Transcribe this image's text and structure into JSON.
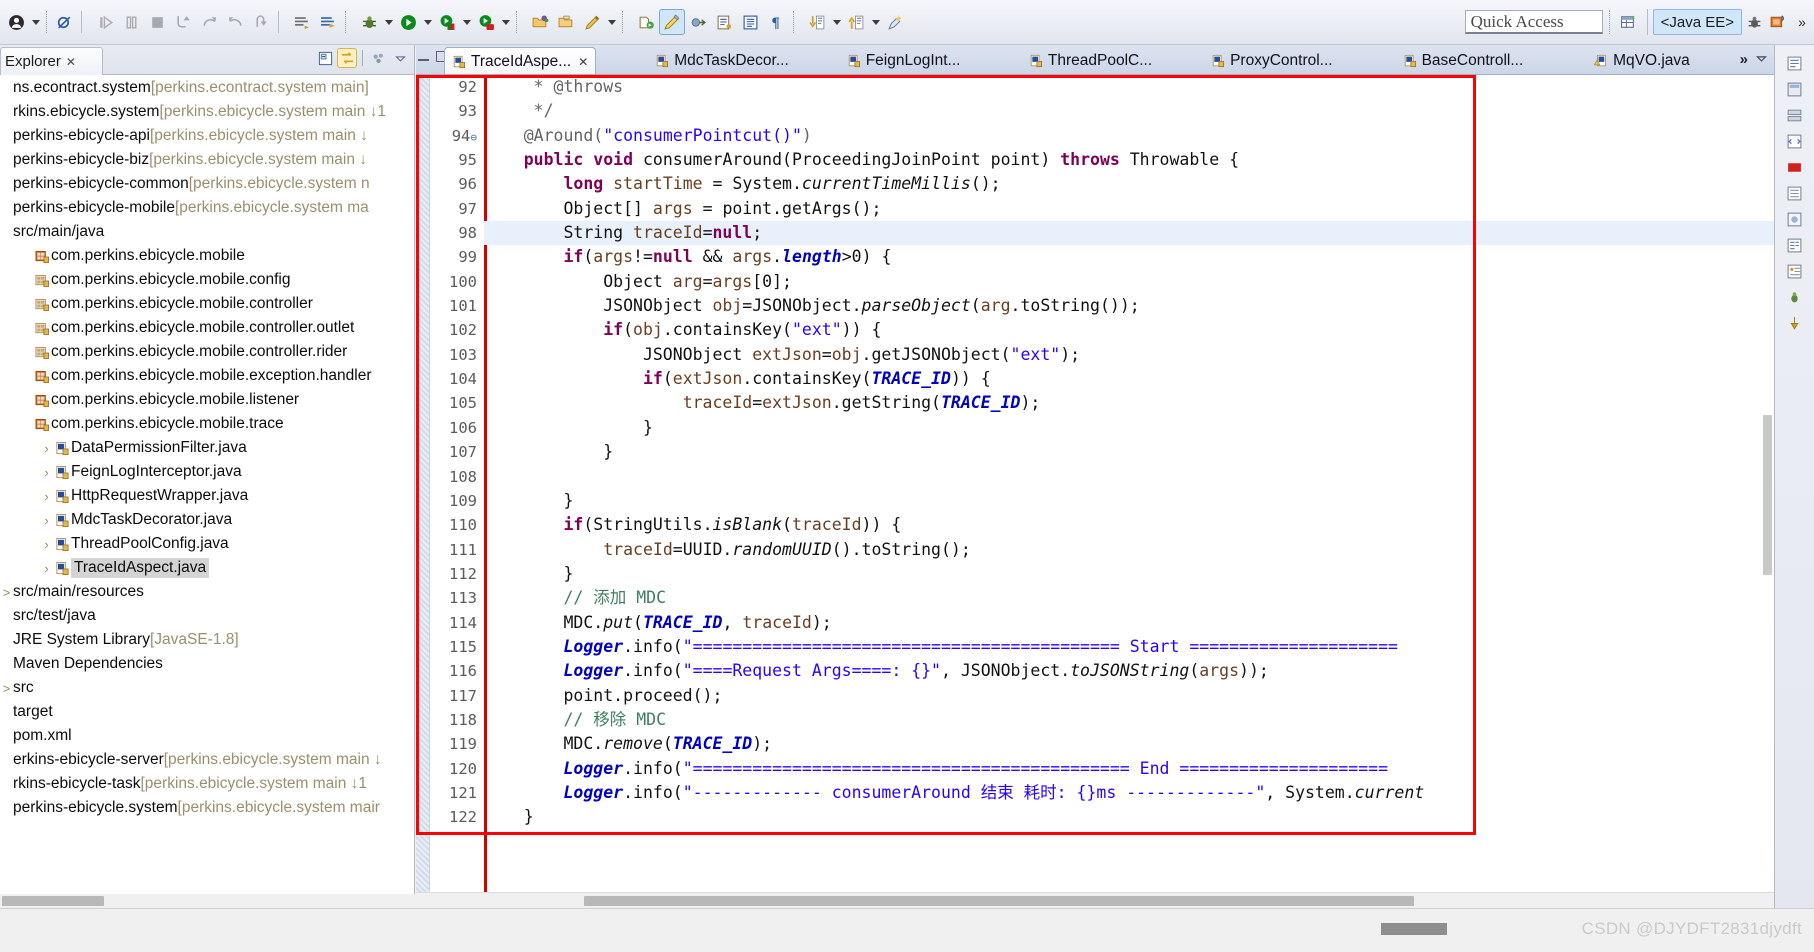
{
  "app": {
    "perspective": "<Java EE>",
    "quick_access_placeholder": "Quick Access"
  },
  "toolbar": {
    "groups": [
      {
        "name": "debug-group",
        "buttons": [
          {
            "name": "debug-user-icon",
            "glyph": "person",
            "caret": true
          },
          {
            "name": "skip-breakpoints-icon",
            "glyph": "skip",
            "caret": false
          }
        ]
      },
      {
        "name": "run-control-group",
        "buttons": [
          {
            "name": "resume-icon",
            "glyph": "resume",
            "caret": false
          },
          {
            "name": "suspend-icon",
            "glyph": "suspend",
            "caret": false
          },
          {
            "name": "terminate-icon",
            "glyph": "stop",
            "caret": false
          },
          {
            "name": "step-into-icon",
            "glyph": "stepinto",
            "caret": false
          },
          {
            "name": "step-over-icon",
            "glyph": "stepover",
            "caret": false
          },
          {
            "name": "step-return-icon",
            "glyph": "stepreturn",
            "caret": false
          },
          {
            "name": "drop-to-frame-icon",
            "glyph": "dropframe",
            "caret": false
          }
        ]
      },
      {
        "name": "console-group",
        "buttons": [
          {
            "name": "open-console-icon",
            "glyph": "console",
            "caret": false
          },
          {
            "name": "pin-console-icon",
            "glyph": "pinconsole",
            "caret": false
          }
        ]
      },
      {
        "name": "launch-group",
        "buttons": [
          {
            "name": "debug-bug-icon",
            "glyph": "bug",
            "caret": true
          },
          {
            "name": "run-icon",
            "glyph": "run",
            "caret": true
          },
          {
            "name": "run-server-icon",
            "glyph": "runserver",
            "caret": true
          },
          {
            "name": "run-external-icon",
            "glyph": "runext",
            "caret": true
          }
        ]
      },
      {
        "name": "resource-group",
        "buttons": [
          {
            "name": "open-type-icon",
            "glyph": "folder-green",
            "caret": false
          },
          {
            "name": "open-resource-icon",
            "glyph": "folder",
            "caret": false
          },
          {
            "name": "new-java-class-icon",
            "glyph": "pencil",
            "caret": true
          }
        ]
      },
      {
        "name": "editor-group",
        "buttons": [
          {
            "name": "new-jsp-icon",
            "glyph": "jsp",
            "caret": false
          },
          {
            "name": "toggle-mark-occurrences-icon",
            "glyph": "highlighter",
            "caret": false,
            "selected": true
          },
          {
            "name": "new-servlet-icon",
            "glyph": "servlet",
            "caret": false
          },
          {
            "name": "open-task-icon",
            "glyph": "tasklist",
            "caret": false
          },
          {
            "name": "show-whitespace-icon",
            "glyph": "book",
            "caret": false
          },
          {
            "name": "pilcrow-icon",
            "glyph": "pilcrow",
            "caret": false
          }
        ]
      },
      {
        "name": "navigation-group",
        "buttons": [
          {
            "name": "next-annotation-icon",
            "glyph": "down-arrow",
            "caret": true
          },
          {
            "name": "previous-annotation-icon",
            "glyph": "up-arrow",
            "caret": true
          }
        ]
      }
    ],
    "overflow_label": "»"
  },
  "explorer": {
    "tab_title": "Explorer",
    "tab_close": "✕",
    "tools": [
      {
        "name": "collapse-all-icon",
        "glyph": "collapse"
      },
      {
        "name": "link-with-editor-icon",
        "glyph": "link",
        "active": true
      },
      {
        "name": "view-menu-icon",
        "glyph": "viewmenu"
      },
      {
        "name": "view-chevron-icon",
        "glyph": "chevron"
      }
    ],
    "tree": [
      {
        "indent": 0,
        "arrow": "",
        "icon": "project",
        "label": "ns.econtract.system",
        "sub": "[perkins.econtract.system main]"
      },
      {
        "indent": 0,
        "arrow": "",
        "icon": "project",
        "label": "rkins.ebicycle.system",
        "sub": "[perkins.ebicycle.system main ↓1"
      },
      {
        "indent": 0,
        "arrow": "",
        "icon": "project",
        "label": "perkins-ebicycle-api",
        "sub": "[perkins.ebicycle.system main ↓"
      },
      {
        "indent": 0,
        "arrow": "",
        "icon": "project",
        "label": "perkins-ebicycle-biz",
        "sub": "[perkins.ebicycle.system main ↓"
      },
      {
        "indent": 0,
        "arrow": "",
        "icon": "project",
        "label": "perkins-ebicycle-common",
        "sub": "[perkins.ebicycle.system n"
      },
      {
        "indent": 0,
        "arrow": "",
        "icon": "project",
        "label": "perkins-ebicycle-mobile",
        "sub": "[perkins.ebicycle.system ma"
      },
      {
        "indent": 1,
        "arrow": "",
        "icon": "srcfolder",
        "label": "src/main/java",
        "sub": ""
      },
      {
        "indent": 2,
        "arrow": "",
        "icon": "package",
        "label": "com.perkins.ebicycle.mobile",
        "sub": ""
      },
      {
        "indent": 2,
        "arrow": "",
        "icon": "package-empty",
        "label": "com.perkins.ebicycle.mobile.config",
        "sub": ""
      },
      {
        "indent": 2,
        "arrow": "",
        "icon": "package-empty",
        "label": "com.perkins.ebicycle.mobile.controller",
        "sub": ""
      },
      {
        "indent": 2,
        "arrow": "",
        "icon": "package-empty",
        "label": "com.perkins.ebicycle.mobile.controller.outlet",
        "sub": ""
      },
      {
        "indent": 2,
        "arrow": "",
        "icon": "package-empty",
        "label": "com.perkins.ebicycle.mobile.controller.rider",
        "sub": ""
      },
      {
        "indent": 2,
        "arrow": "",
        "icon": "package",
        "label": "com.perkins.ebicycle.mobile.exception.handler",
        "sub": ""
      },
      {
        "indent": 2,
        "arrow": "",
        "icon": "package",
        "label": "com.perkins.ebicycle.mobile.listener",
        "sub": ""
      },
      {
        "indent": 2,
        "arrow": "",
        "icon": "package",
        "label": "com.perkins.ebicycle.mobile.trace",
        "sub": ""
      },
      {
        "indent": 3,
        "arrow": "›",
        "icon": "java",
        "label": "DataPermissionFilter.java",
        "sub": ""
      },
      {
        "indent": 3,
        "arrow": "›",
        "icon": "java",
        "label": "FeignLogInterceptor.java",
        "sub": ""
      },
      {
        "indent": 3,
        "arrow": "›",
        "icon": "java",
        "label": "HttpRequestWrapper.java",
        "sub": ""
      },
      {
        "indent": 3,
        "arrow": "›",
        "icon": "java",
        "label": "MdcTaskDecorator.java",
        "sub": ""
      },
      {
        "indent": 3,
        "arrow": "›",
        "icon": "java",
        "label": "ThreadPoolConfig.java",
        "sub": ""
      },
      {
        "indent": 3,
        "arrow": "›",
        "icon": "java",
        "label": "TraceIdAspect.java",
        "sub": "",
        "selected": true
      },
      {
        "indent": 0,
        "arrow": ">",
        "icon": "srcfolder",
        "label": "src/main/resources",
        "sub": ""
      },
      {
        "indent": 0,
        "arrow": "",
        "icon": "srcfolder",
        "label": "src/test/java",
        "sub": ""
      },
      {
        "indent": 0,
        "arrow": "",
        "icon": "library",
        "label": "JRE System Library",
        "sub": "[JavaSE-1.8]"
      },
      {
        "indent": 0,
        "arrow": "",
        "icon": "library",
        "label": "Maven Dependencies",
        "sub": ""
      },
      {
        "indent": 0,
        "arrow": ">",
        "icon": "folder",
        "label": "src",
        "sub": ""
      },
      {
        "indent": 0,
        "arrow": "",
        "icon": "folder",
        "label": "target",
        "sub": ""
      },
      {
        "indent": 0,
        "arrow": "",
        "icon": "xml",
        "label": "pom.xml",
        "sub": ""
      },
      {
        "indent": 0,
        "arrow": "",
        "icon": "project",
        "label": "erkins-ebicycle-server",
        "sub": "[perkins.ebicycle.system main ↓"
      },
      {
        "indent": 0,
        "arrow": "",
        "icon": "project",
        "label": "rkins-ebicycle-task",
        "sub": "[perkins.ebicycle.system main ↓1"
      },
      {
        "indent": 0,
        "arrow": "",
        "icon": "project",
        "label": "perkins-ebicycle.system",
        "sub": "[perkins.ebicycle.system mair"
      }
    ]
  },
  "editor": {
    "tabs": [
      {
        "label": "TraceIdAspe...",
        "active": true,
        "closable": true,
        "warn": false
      },
      {
        "label": "MdcTaskDecor...",
        "active": false,
        "closable": false,
        "warn": false
      },
      {
        "label": "FeignLogInt...",
        "active": false,
        "closable": false,
        "warn": false
      },
      {
        "label": "ThreadPoolC...",
        "active": false,
        "closable": false,
        "warn": false
      },
      {
        "label": "ProxyControl...",
        "active": false,
        "closable": false,
        "warn": false
      },
      {
        "label": "BaseControll...",
        "active": false,
        "closable": false,
        "warn": false
      },
      {
        "label": "MqVO.java",
        "active": false,
        "closable": false,
        "warn": true
      }
    ],
    "tab_overflow": "»",
    "first_line_number": 92,
    "lines": [
      {
        "n": 92,
        "fold": false,
        "html": "     <span class='ann'>* @throws</span>"
      },
      {
        "n": 93,
        "fold": false,
        "html": "     <span class='ann'>*/</span>"
      },
      {
        "n": 94,
        "fold": true,
        "html": "    <span class='ann'>@Around(</span><span class='str'>\"consumerPointcut()\"</span><span class='ann'>)</span>"
      },
      {
        "n": 95,
        "fold": false,
        "html": "    <span class='kw'>public</span> <span class='kw'>void</span> consumerAround(ProceedingJoinPoint point) <span class='kw'>throws</span> Throwable {"
      },
      {
        "n": 96,
        "fold": false,
        "html": "        <span class='kw'>long</span> <span class='loc'>startTime</span> = System.<span class='stat'>currentTimeMillis</span>();"
      },
      {
        "n": 97,
        "fold": false,
        "html": "        Object[] <span class='loc'>args</span> = point.getArgs();"
      },
      {
        "n": 98,
        "fold": false,
        "hl": true,
        "html": "        String <span class='loc'>traceId</span>=<span class='kw'>null</span>;"
      },
      {
        "n": 99,
        "fold": false,
        "html": "        <span class='kw'>if</span>(<span class='loc'>args</span>!=<span class='kw'>null</span> &amp;&amp; <span class='loc'>args</span>.<span class='fld'>length</span>&gt;0) {"
      },
      {
        "n": 100,
        "fold": false,
        "html": "            Object <span class='loc'>arg</span>=<span class='loc'>args</span>[0];"
      },
      {
        "n": 101,
        "fold": false,
        "html": "            JSONObject <span class='loc'>obj</span>=JSONObject.<span class='stat'>parseObject</span>(<span class='loc'>arg</span>.toString());"
      },
      {
        "n": 102,
        "fold": false,
        "html": "            <span class='kw'>if</span>(<span class='loc'>obj</span>.containsKey(<span class='str'>\"ext\"</span>)) {"
      },
      {
        "n": 103,
        "fold": false,
        "html": "                JSONObject <span class='loc'>extJson</span>=<span class='loc'>obj</span>.getJSONObject(<span class='str'>\"ext\"</span>);"
      },
      {
        "n": 104,
        "fold": false,
        "html": "                <span class='kw'>if</span>(<span class='loc'>extJson</span>.containsKey(<span class='statb'>TRACE_ID</span>)) {"
      },
      {
        "n": 105,
        "fold": false,
        "html": "                    <span class='loc'>traceId</span>=<span class='loc'>extJson</span>.getString(<span class='statb'>TRACE_ID</span>);"
      },
      {
        "n": 106,
        "fold": false,
        "html": "                }"
      },
      {
        "n": 107,
        "fold": false,
        "html": "            }"
      },
      {
        "n": 108,
        "fold": false,
        "html": ""
      },
      {
        "n": 109,
        "fold": false,
        "html": "        }"
      },
      {
        "n": 110,
        "fold": false,
        "html": "        <span class='kw'>if</span>(StringUtils.<span class='stat'>isBlank</span>(<span class='loc'>traceId</span>)) {"
      },
      {
        "n": 111,
        "fold": false,
        "html": "            <span class='loc'>traceId</span>=UUID.<span class='stat'>randomUUID</span>().toString();"
      },
      {
        "n": 112,
        "fold": false,
        "html": "        }"
      },
      {
        "n": 113,
        "fold": false,
        "html": "        <span class='cmt'>// 添加 MDC</span>"
      },
      {
        "n": 114,
        "fold": false,
        "html": "        MDC.<span class='stat'>put</span>(<span class='statb'>TRACE_ID</span>, <span class='loc'>traceId</span>);"
      },
      {
        "n": 115,
        "fold": false,
        "html": "        <span class='fld'>Logger</span>.info(<span class='str'>\"=========================================== Start =====================</span>"
      },
      {
        "n": 116,
        "fold": false,
        "html": "        <span class='fld'>Logger</span>.info(<span class='str'>\"====Request Args====: {}\"</span>, JSONObject.<span class='stat'>toJSONString</span>(<span class='loc'>args</span>));"
      },
      {
        "n": 117,
        "fold": false,
        "html": "        point.proceed();"
      },
      {
        "n": 118,
        "fold": false,
        "html": "        <span class='cmt'>// 移除 MDC</span>"
      },
      {
        "n": 119,
        "fold": false,
        "html": "        MDC.<span class='stat'>remove</span>(<span class='statb'>TRACE_ID</span>);"
      },
      {
        "n": 120,
        "fold": false,
        "html": "        <span class='fld'>Logger</span>.info(<span class='str'>\"============================================ End =====================</span>"
      },
      {
        "n": 121,
        "fold": false,
        "html": "        <span class='fld'>Logger</span>.info(<span class='str'>\"------------- consumerAround 结束 耗时: {}ms -------------\"</span>, System.<span class='stat'>current</span>"
      },
      {
        "n": 122,
        "fold": false,
        "html": "    }"
      }
    ]
  },
  "statusbar": {
    "watermark": "CSDN @DJYDFT2831djydft"
  }
}
